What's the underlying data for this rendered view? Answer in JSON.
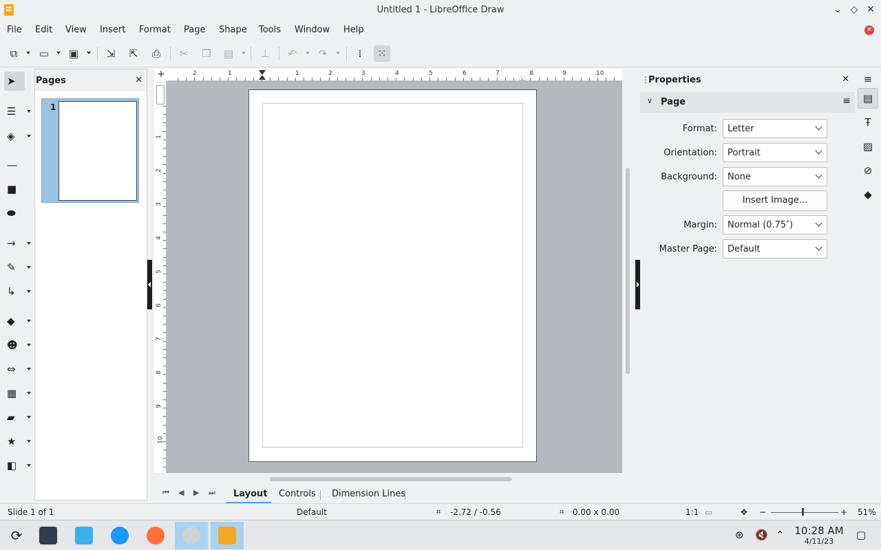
{
  "window": {
    "title": "Untitled 1 - LibreOffice Draw"
  },
  "menu": [
    "File",
    "Edit",
    "View",
    "Insert",
    "Format",
    "Page",
    "Shape",
    "Tools",
    "Window",
    "Help"
  ],
  "pages_panel": {
    "title": "Pages",
    "thumb_number": "1"
  },
  "properties": {
    "title": "Properties",
    "section": "Page",
    "format_label": "Format:",
    "format_value": "Letter",
    "orientation_label": "Orientation:",
    "orientation_value": "Portrait",
    "background_label": "Background:",
    "background_value": "None",
    "insert_image": "Insert Image...",
    "margin_label": "Margin:",
    "margin_value": "Normal (0.75″)",
    "master_label": "Master Page:",
    "master_value": "Default"
  },
  "ruler": {
    "h_labels": [
      "2",
      "1",
      "1",
      "2",
      "3",
      "4",
      "5",
      "6",
      "7",
      "8",
      "9",
      "10"
    ],
    "v_labels": [
      "1",
      "2",
      "3",
      "4",
      "5",
      "6",
      "7",
      "8",
      "9",
      "10"
    ]
  },
  "tabs": [
    "Layout",
    "Controls",
    "Dimension Lines"
  ],
  "status": {
    "slide": "Slide 1 of 1",
    "layout": "Default",
    "position": "-2.72 / -0.56",
    "size": "0.00 x 0.00",
    "scale": "1:1",
    "zoom": "51%"
  },
  "taskbar": {
    "time": "10:28 AM",
    "date": "4/11/23"
  },
  "colors": {
    "accent": "#3daee9",
    "selected_thumb": "#9dc3e2",
    "canvas_bg": "#b6b9bd",
    "close_red": "#da4453"
  }
}
